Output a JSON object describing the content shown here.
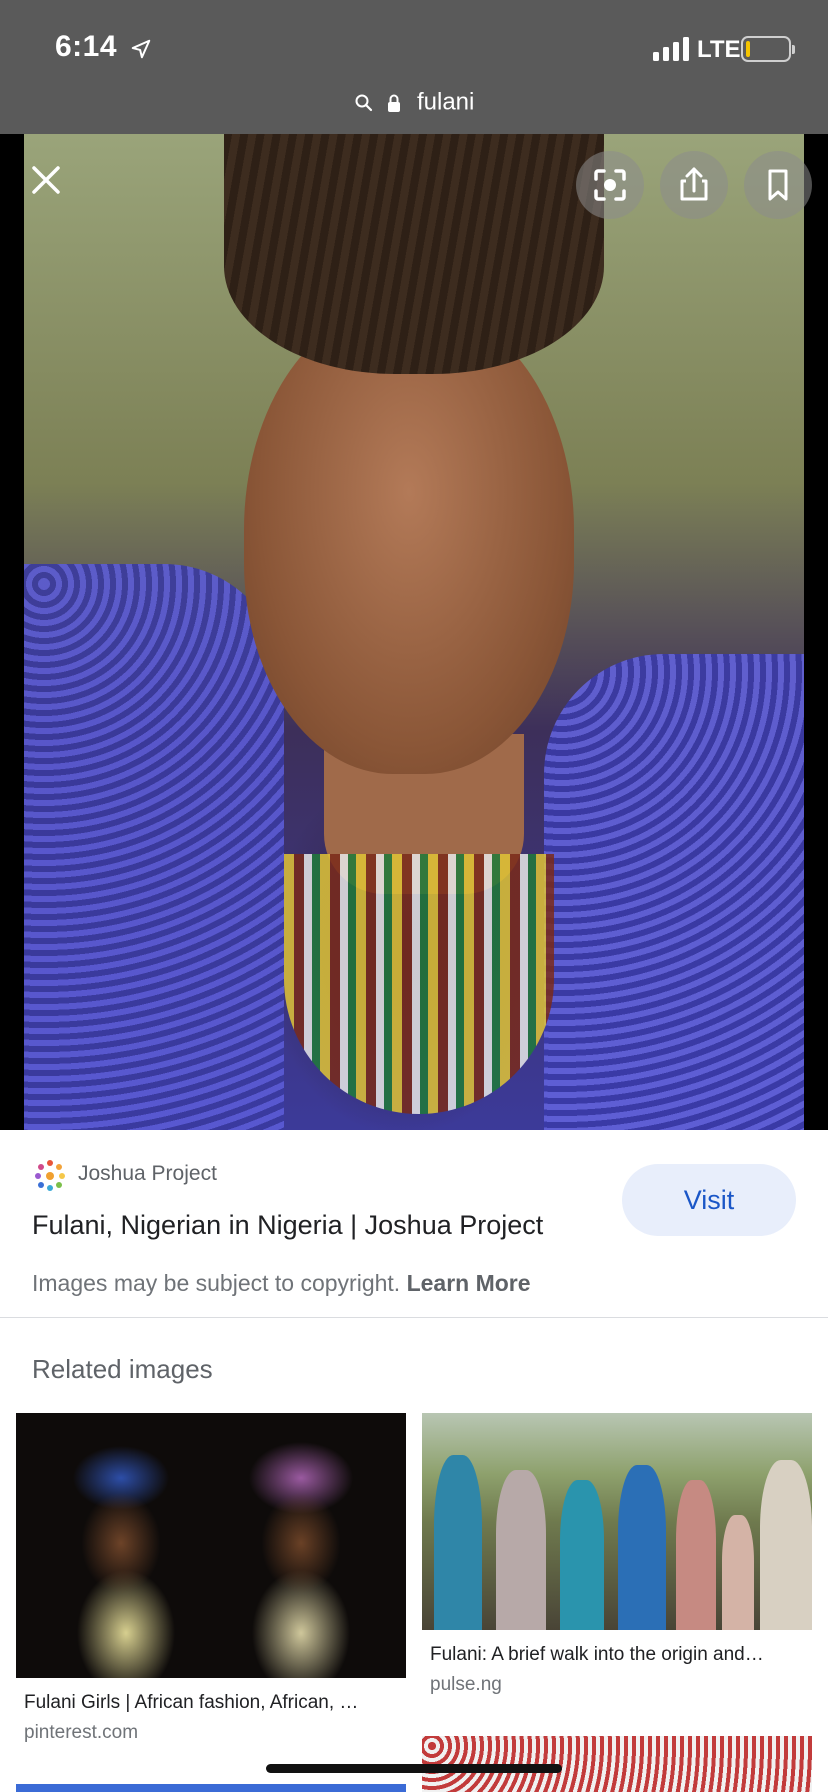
{
  "status_bar": {
    "time": "6:14",
    "network": "LTE",
    "battery_level": 0.1,
    "battery_color": "#f5c400"
  },
  "address_bar": {
    "url_text": "fulani",
    "icons": [
      "search-icon",
      "lock-icon"
    ]
  },
  "viewer": {
    "buttons": [
      "close-icon",
      "lens-icon",
      "share-icon",
      "bookmark-icon"
    ]
  },
  "result": {
    "source_name": "Joshua Project",
    "title": "Fulani, Nigerian in Nigeria | Joshua Project",
    "visit_label": "Visit",
    "copyright_text": "Images may be subject to copyright.",
    "learn_more_label": "Learn More"
  },
  "related": {
    "heading": "Related images",
    "items": [
      {
        "caption": "Fulani Girls | African fashion, African, …",
        "domain": "pinterest.com"
      },
      {
        "caption": "Fulani: A brief walk into the origin and…",
        "domain": "pulse.ng"
      }
    ]
  },
  "colors": {
    "visit_bg": "#e8eefb",
    "visit_text": "#1a56c7",
    "topbar_bg": "#5a5a5a"
  }
}
